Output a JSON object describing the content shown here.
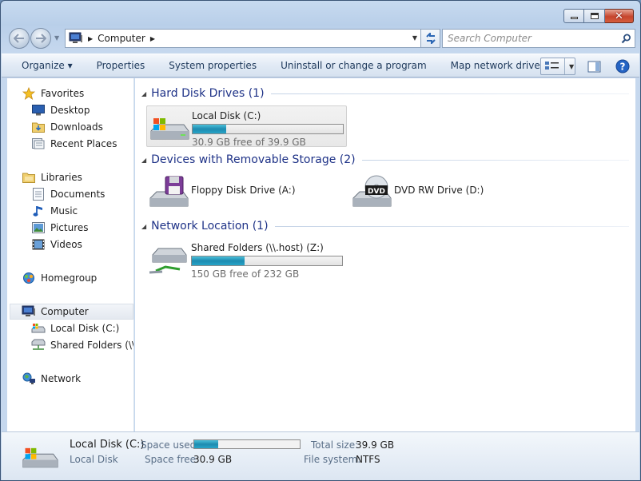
{
  "window": {
    "caption_close": "✕"
  },
  "address_bar": {
    "crumb": "Computer",
    "search_placeholder": "Search Computer"
  },
  "toolbar": {
    "organize": "Organize ▾",
    "properties": "Properties",
    "system_properties": "System properties",
    "uninstall": "Uninstall or change a program",
    "map_drive": "Map network drive",
    "more": "»"
  },
  "nav_pane": {
    "favorites": "Favorites",
    "desktop": "Desktop",
    "downloads": "Downloads",
    "recent_places": "Recent Places",
    "libraries": "Libraries",
    "documents": "Documents",
    "music": "Music",
    "pictures": "Pictures",
    "videos": "Videos",
    "homegroup": "Homegroup",
    "computer": "Computer",
    "local_disk": "Local Disk (C:)",
    "shared_folders": "Shared Folders (\\\\.host) (Z:)",
    "network": "Network"
  },
  "groups": {
    "hard_disks": "Hard Disk Drives (1)",
    "removable": "Devices with Removable Storage (2)",
    "network": "Network Location (1)"
  },
  "drives": {
    "local_disk": {
      "name": "Local Disk (C:)",
      "free_text": "30.9 GB free of 39.9 GB",
      "used_fraction": 0.226
    },
    "floppy": {
      "name": "Floppy Disk Drive (A:)"
    },
    "dvd": {
      "name": "DVD RW Drive (D:)",
      "badge": "DVD"
    },
    "shared": {
      "name": "Shared Folders (\\\\.host) (Z:)",
      "free_text": "150 GB free of 232 GB",
      "used_fraction": 0.353
    }
  },
  "details": {
    "name": "Local Disk (C:)",
    "type": "Local Disk",
    "space_used_label": "Space used:",
    "space_free_label": "Space free:",
    "space_free_value": "30.9 GB",
    "total_size_label": "Total size:",
    "total_size_value": "39.9 GB",
    "file_system_label": "File system:",
    "file_system_value": "NTFS",
    "used_fraction": 0.226
  },
  "colors": {
    "accent": "#1e3287",
    "bar_fill": "#1d8bb0"
  }
}
